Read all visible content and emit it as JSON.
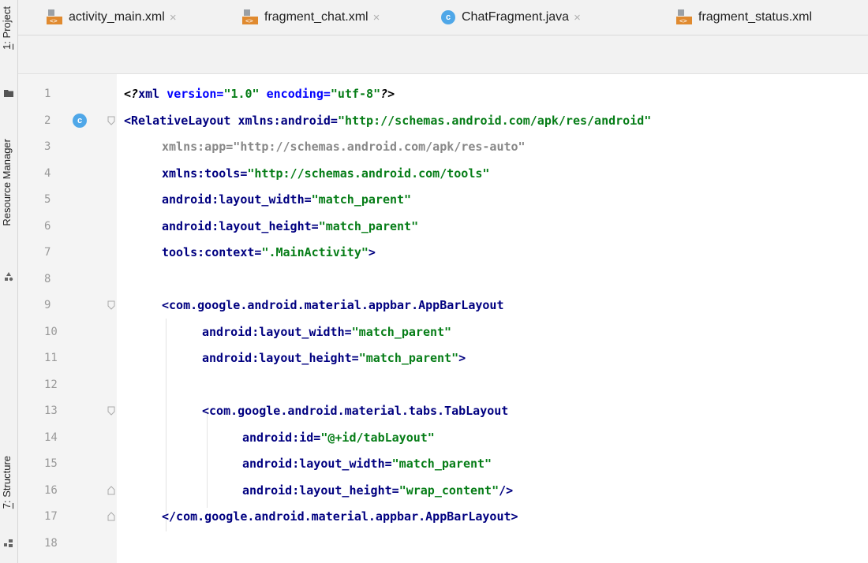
{
  "tool_strip": {
    "project": {
      "num": "1",
      "label": ": Project"
    },
    "resource_manager": {
      "label": "Resource Manager"
    },
    "structure": {
      "num": "7",
      "label": ": Structure"
    }
  },
  "tabs": [
    {
      "label": "activity_main.xml",
      "icon": "xml-file-icon"
    },
    {
      "label": "fragment_chat.xml",
      "icon": "xml-file-icon"
    },
    {
      "label": "ChatFragment.java",
      "icon": "java-class-icon"
    },
    {
      "label": "fragment_status.xml",
      "icon": "xml-file-icon"
    }
  ],
  "close_glyph": "×",
  "class_badge": "c",
  "lines": [
    {
      "n": "1",
      "parts": [
        {
          "t": "<?xml version=\"1.0\" encoding=\"utf-8\"?>",
          "c": "mix1"
        }
      ]
    },
    {
      "n": "2",
      "parts": [
        {
          "t": "<RelativeLayout xmlns:android=\"http://schemas.android.com/apk/res/android\"",
          "c": "mix2"
        }
      ]
    },
    {
      "n": "3",
      "parts": [
        {
          "t": "xmlns:app=\"http://schemas.android.com/apk/res-auto\"",
          "c": "gray"
        }
      ]
    },
    {
      "n": "4",
      "parts": [
        {
          "t": "xmlns:tools=\"http://schemas.android.com/tools\"",
          "c": "attrval"
        }
      ]
    },
    {
      "n": "5",
      "parts": [
        {
          "t": "android:layout_width=\"match_parent\"",
          "c": "attrval"
        }
      ]
    },
    {
      "n": "6",
      "parts": [
        {
          "t": "android:layout_height=\"match_parent\"",
          "c": "attrval"
        }
      ]
    },
    {
      "n": "7",
      "parts": [
        {
          "t": "tools:context=\".MainActivity\">",
          "c": "attrval"
        }
      ]
    },
    {
      "n": "8",
      "parts": []
    },
    {
      "n": "9",
      "parts": [
        {
          "t": "<com.google.android.material.appbar.AppBarLayout",
          "c": "tag"
        }
      ]
    },
    {
      "n": "10",
      "parts": [
        {
          "t": "android:layout_width=\"match_parent\"",
          "c": "attrval"
        }
      ]
    },
    {
      "n": "11",
      "parts": [
        {
          "t": "android:layout_height=\"match_parent\">",
          "c": "attrval"
        }
      ]
    },
    {
      "n": "12",
      "parts": []
    },
    {
      "n": "13",
      "parts": [
        {
          "t": "<com.google.android.material.tabs.TabLayout",
          "c": "tag"
        }
      ]
    },
    {
      "n": "14",
      "parts": [
        {
          "t": "android:id=\"@+id/tabLayout\"",
          "c": "attrval"
        }
      ]
    },
    {
      "n": "15",
      "parts": [
        {
          "t": "android:layout_width=\"match_parent\"",
          "c": "attrval"
        }
      ]
    },
    {
      "n": "16",
      "parts": [
        {
          "t": "android:layout_height=\"wrap_content\"/>",
          "c": "attrval"
        }
      ]
    },
    {
      "n": "17",
      "parts": [
        {
          "t": "</com.google.android.material.appbar.AppBarLayout>",
          "c": "tag"
        }
      ]
    },
    {
      "n": "18",
      "parts": []
    }
  ],
  "colors": {
    "tag": "#000080",
    "attr": "#0000ff",
    "value": "#067d17",
    "gutter": "#f4f4f4",
    "badge": "#4fa7e8"
  }
}
